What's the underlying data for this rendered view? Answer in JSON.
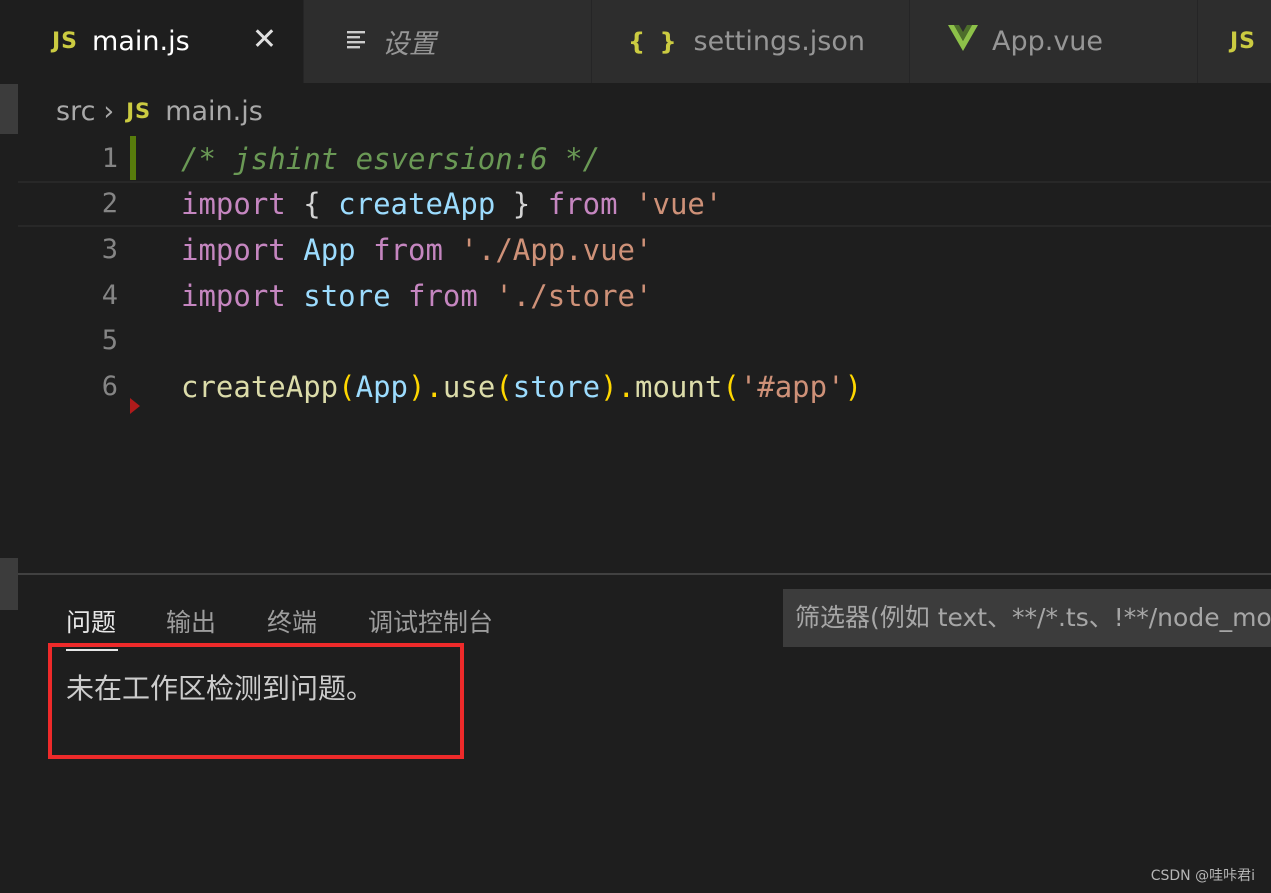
{
  "tabs": [
    {
      "icon": "JS",
      "label": "main.js",
      "active": true
    },
    {
      "icon": "settings-icon",
      "label": "设置",
      "active": false
    },
    {
      "icon": "{ }",
      "label": "settings.json",
      "active": false
    },
    {
      "icon": "vue-icon",
      "label": "App.vue",
      "active": false
    },
    {
      "icon": "JS",
      "label": "",
      "active": false
    }
  ],
  "close_glyph": "✕",
  "breadcrumb": {
    "folder": "src",
    "separator": "›",
    "file_icon": "JS",
    "file": "main.js"
  },
  "code": {
    "line_numbers": [
      "1",
      "2",
      "3",
      "4",
      "5",
      "6"
    ],
    "line1": "/* jshint esversion:6 */",
    "line2": {
      "kw1": "import",
      "open": "{",
      "name": "createApp",
      "close": "}",
      "kw2": "from",
      "str": "'vue'"
    },
    "line3": {
      "kw1": "import",
      "name": "App",
      "kw2": "from",
      "str": "'./App.vue'"
    },
    "line4": {
      "kw1": "import",
      "name": "store",
      "kw2": "from",
      "str": "'./store'"
    },
    "line6": {
      "fn1": "createApp",
      "p1": "(",
      "arg1": "App",
      "p2": ").",
      "fn2": "use",
      "p3": "(",
      "arg2": "store",
      "p4": ").",
      "fn3": "mount",
      "p5": "(",
      "str": "'#app'",
      "p6": ")"
    }
  },
  "panel": {
    "tabs": [
      "问题",
      "输出",
      "终端",
      "调试控制台"
    ],
    "active_tab": "问题",
    "filter_placeholder": "筛选器(例如 text、**/*.ts、!**/node_modules/**)",
    "message": "未在工作区检测到问题。"
  },
  "watermark": "CSDN @哇咔君i",
  "colors": {
    "accent_highlight": "#ee2a2a",
    "js_icon": "#cbcb41",
    "vue_icon": "#8dc149"
  }
}
